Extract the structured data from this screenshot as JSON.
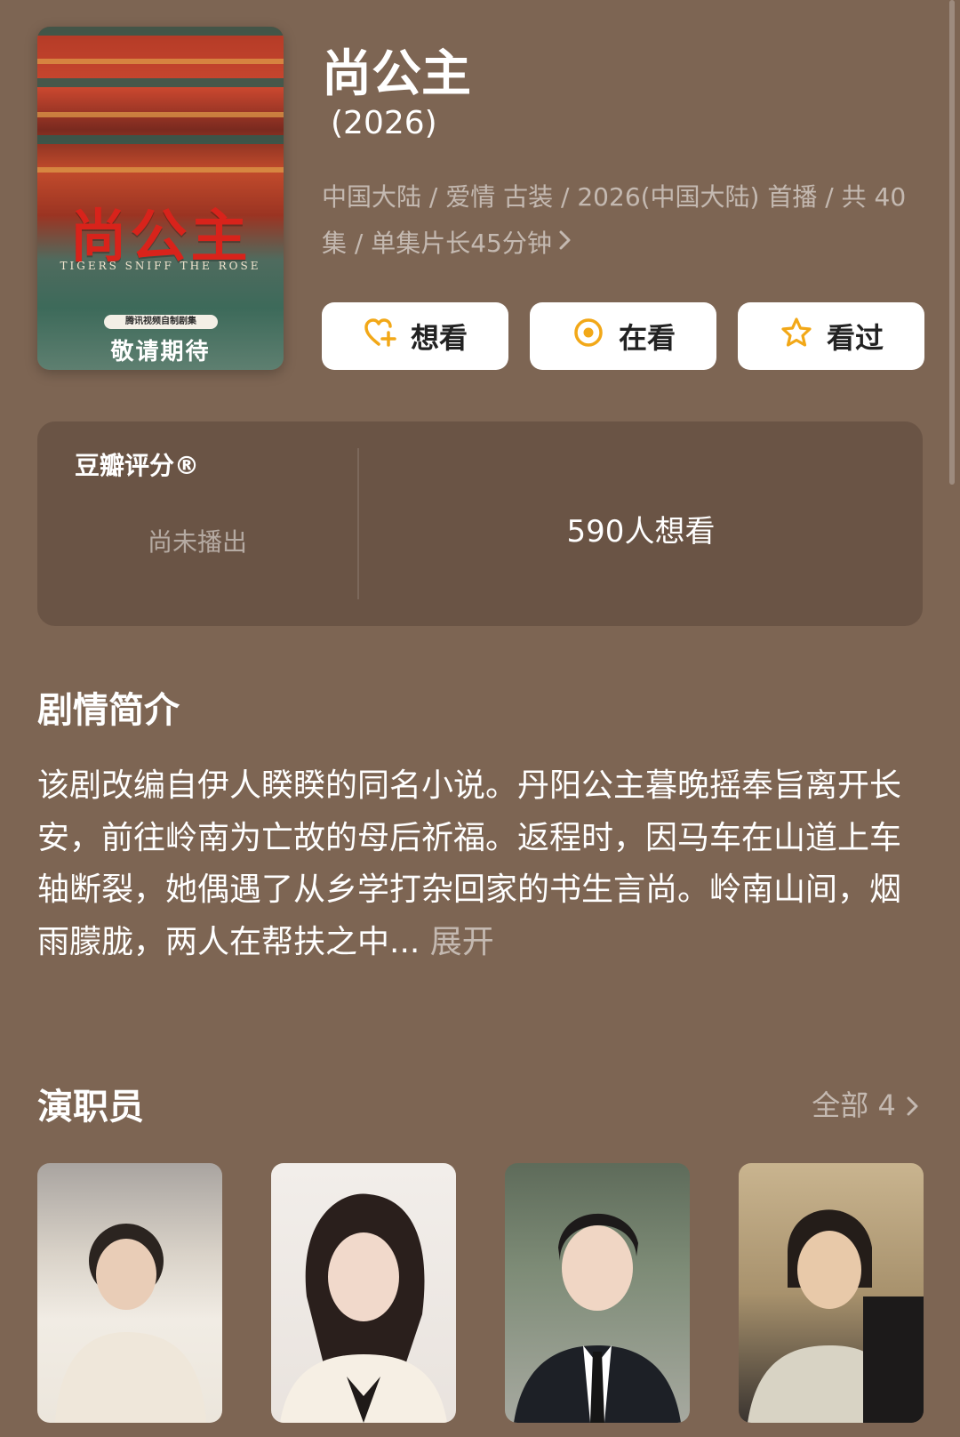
{
  "header": {
    "title": "尚公主",
    "year": "(2026)",
    "meta": "中国大陆 / 爱情 古装 / 2026(中国大陆) 首播 / 共 40集 / 单集片长45分钟"
  },
  "poster": {
    "title_text": "尚公主",
    "subtitle_text": "TIGERS SNIFF THE ROSE",
    "badge_text": "腾讯视频自制剧集",
    "soon_text": "敬请期待"
  },
  "actions": [
    {
      "label": "想看",
      "icon": "heart-plus-icon"
    },
    {
      "label": "在看",
      "icon": "target-icon"
    },
    {
      "label": "看过",
      "icon": "star-icon"
    }
  ],
  "rating": {
    "label": "豆瓣评分®",
    "status": "尚未播出",
    "want_count": "590人想看"
  },
  "synopsis": {
    "heading": "剧情简介",
    "text": "该剧改编自伊人睽睽的同名小说。丹阳公主暮晚摇奉旨离开长安，前往岭南为亡故的母后祈福。返程时，因马车在山道上车轴断裂，她偶遇了从乡学打杂回家的书生言尚。岭南山间，烟雨朦胧，两人在帮扶之中...",
    "expand_label": "展开"
  },
  "cast": {
    "heading": "演职员",
    "all_label": "全部 4",
    "members": [
      {
        "photo": "cast-photo-1"
      },
      {
        "photo": "cast-photo-2"
      },
      {
        "photo": "cast-photo-3"
      },
      {
        "photo": "cast-photo-4"
      }
    ]
  },
  "colors": {
    "background": "#7d6553",
    "card": "#6a5445",
    "accent_icon": "#f2a818"
  }
}
